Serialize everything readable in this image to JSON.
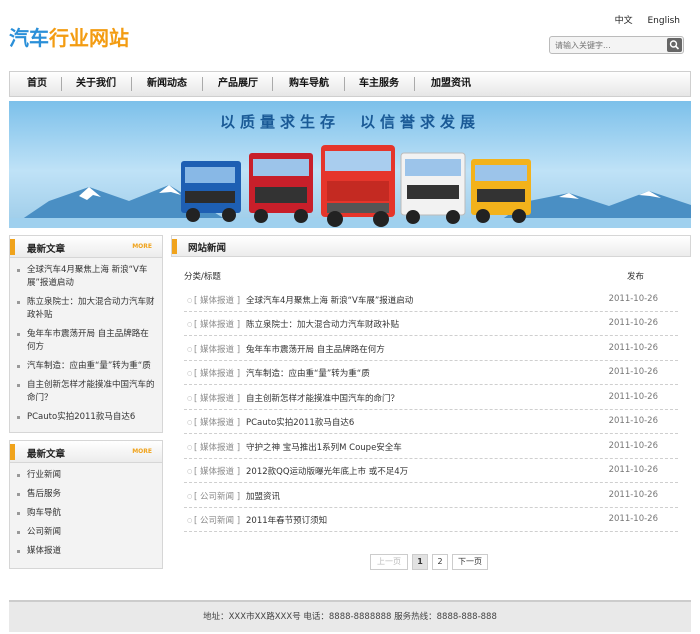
{
  "header": {
    "logo_part1": "汽车",
    "logo_part2": "行业网站",
    "lang_cn": "中文",
    "lang_en": "English",
    "search_placeholder": "请输入关键字..."
  },
  "nav": {
    "items": [
      "首页",
      "关于我们",
      "新闻动态",
      "产品展厅",
      "购车导航",
      "车主服务",
      "加盟资讯"
    ]
  },
  "banner": {
    "slogan": "以质量求生存　以信誉求发展"
  },
  "sidebar": {
    "box1": {
      "title": "最新文章",
      "more": "MORE",
      "items": [
        "全球汽车4月聚焦上海 新浪“V车展”报道启动",
        "陈立泉院士：加大混合动力汽车财政补贴",
        "兔年车市震荡开局 自主品牌路在何方",
        "汽车制造：应由重“量”转为重“质",
        "自主创新怎样才能摸准中国汽车的命门？",
        "PCauto实拍2011款马自达6"
      ]
    },
    "box2": {
      "title": "最新文章",
      "more": "MORE",
      "items": [
        "行业新闻",
        "售后服务",
        "购车导航",
        "公司新闻",
        "媒体报道"
      ]
    }
  },
  "main": {
    "title": "网站新闻",
    "col_title": "分类/标题",
    "col_date": "发布",
    "rows": [
      {
        "cat": "[ 媒体报道 ]",
        "title": "全球汽车4月聚焦上海 新浪“V车展”报道启动",
        "date": "2011-10-26"
      },
      {
        "cat": "[ 媒体报道 ]",
        "title": "陈立泉院士：加大混合动力汽车财政补贴",
        "date": "2011-10-26"
      },
      {
        "cat": "[ 媒体报道 ]",
        "title": "兔年车市震荡开局 自主品牌路在何方",
        "date": "2011-10-26"
      },
      {
        "cat": "[ 媒体报道 ]",
        "title": "汽车制造：应由重“量”转为重“质",
        "date": "2011-10-26"
      },
      {
        "cat": "[ 媒体报道 ]",
        "title": "自主创新怎样才能摸准中国汽车的命门？",
        "date": "2011-10-26"
      },
      {
        "cat": "[ 媒体报道 ]",
        "title": "PCauto实拍2011款马自达6",
        "date": "2011-10-26"
      },
      {
        "cat": "[ 媒体报道 ]",
        "title": "守护之神 宝马推出1系列M Coupe安全车",
        "date": "2011-10-26"
      },
      {
        "cat": "[ 媒体报道 ]",
        "title": "2012款QQ运动版曝光年底上市 或不足4万",
        "date": "2011-10-26"
      },
      {
        "cat": "[ 公司新闻 ]",
        "title": "加盟资讯",
        "date": "2011-10-26"
      },
      {
        "cat": "[ 公司新闻 ]",
        "title": "2011年春节预订须知",
        "date": "2011-10-26"
      }
    ]
  },
  "pager": {
    "prev": "上一页",
    "p1": "1",
    "p2": "2",
    "next": "下一页"
  },
  "footer": {
    "text": "地址：XXX市XX路XXX号 电话：8888-8888888 服务热线：8888-888-888"
  },
  "colors": {
    "accent": "#f0a31c",
    "logo_blue": "#2a8fd8",
    "logo_orange": "#f39c12"
  }
}
